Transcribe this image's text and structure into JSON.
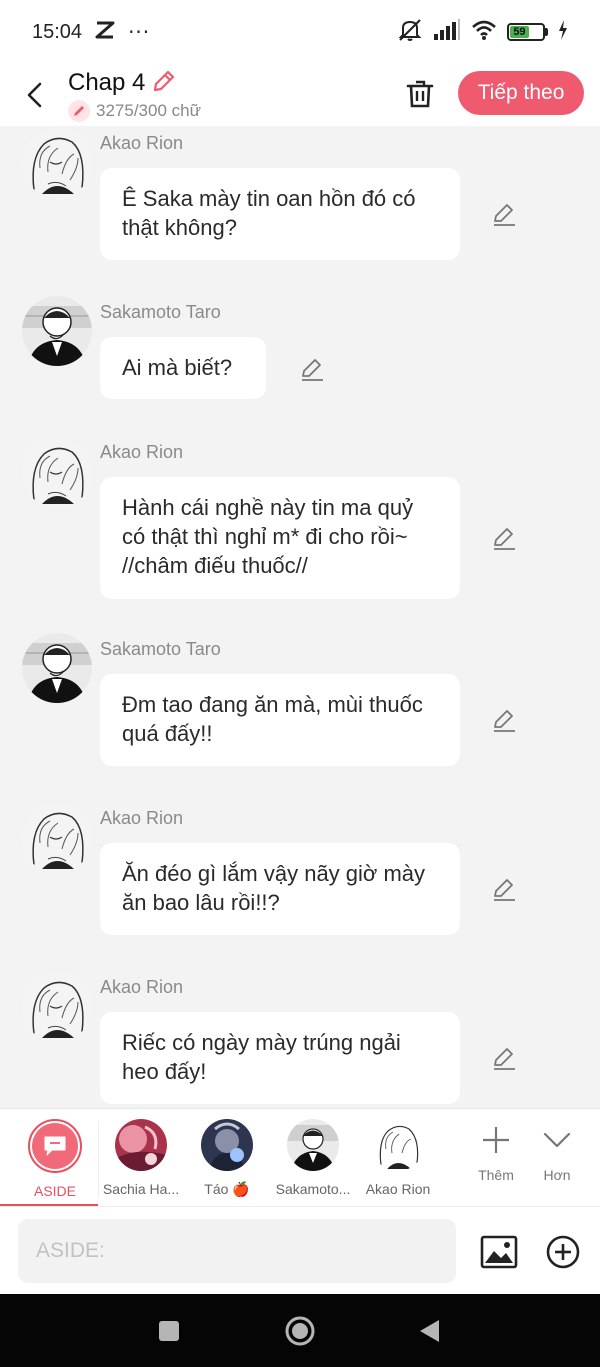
{
  "status_bar": {
    "time": "15:04",
    "notif_icon": "double-x-icon",
    "dots": "···",
    "battery_level": 59,
    "battery_text": "59"
  },
  "header": {
    "title": "Chap 4",
    "word_count": "3275/300 chữ",
    "next_label": "Tiếp theo"
  },
  "messages": [
    {
      "sender": "Akao Rion",
      "text": "Ê Saka mày tin oan hồn đó có thật không?",
      "avatar": "rion"
    },
    {
      "sender": "Sakamoto Taro",
      "text": "Ai mà biết?",
      "avatar": "taro"
    },
    {
      "sender": "Akao Rion",
      "text": "Hành cái nghề này tin ma quỷ có thật thì nghỉ m* đi cho rồi~ //châm điếu thuốc//",
      "avatar": "rion"
    },
    {
      "sender": "Sakamoto Taro",
      "text": "Đm tao đang ăn mà, mùi thuốc quá đấy!!",
      "avatar": "taro"
    },
    {
      "sender": "Akao Rion",
      "text": "Ăn đéo gì lắm vậy nãy giờ mày ăn bao lâu rồi!!?",
      "avatar": "rion"
    },
    {
      "sender": "Akao Rion",
      "text": "Riếc có ngày mày trúng ngải heo đấy!",
      "avatar": "rion"
    }
  ],
  "characters": [
    {
      "label": "ASIDE",
      "active": true
    },
    {
      "label": "Sachia Ha..."
    },
    {
      "label": "Táo 🍎"
    },
    {
      "label": "Sakamoto..."
    },
    {
      "label": "Akao Rion"
    }
  ],
  "tools": {
    "more_label": "Thêm",
    "expand_label": "Hơn"
  },
  "input": {
    "placeholder": "ASIDE:",
    "value": ""
  },
  "colors": {
    "accent": "#f05a6e",
    "background": "#f3f3f3",
    "bubble": "#ffffff"
  }
}
